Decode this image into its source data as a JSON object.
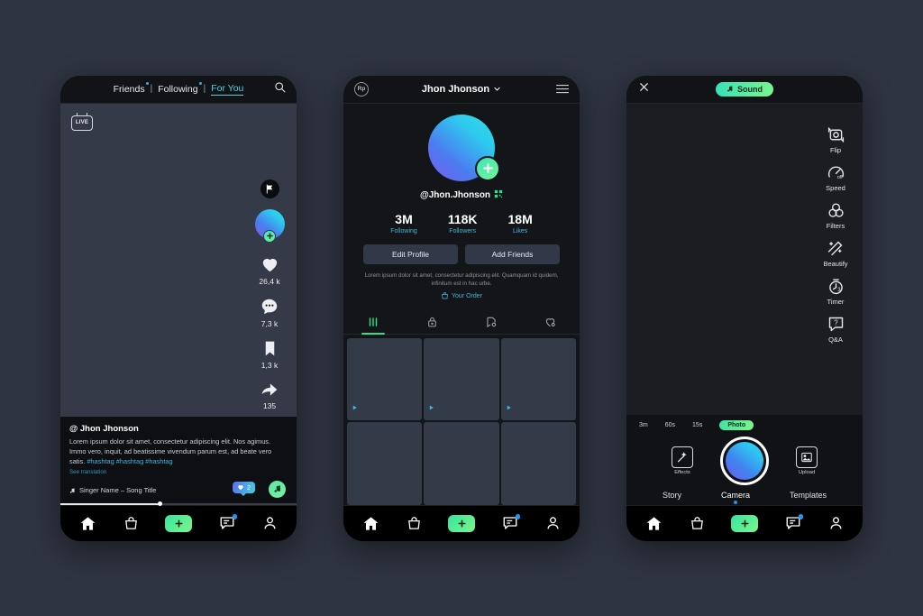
{
  "phone1": {
    "tabs": [
      {
        "label": "Friends",
        "has_dot": true,
        "active": false
      },
      {
        "label": "Following",
        "has_dot": true,
        "active": false
      },
      {
        "label": "For You",
        "has_dot": false,
        "active": true
      }
    ],
    "separator": "|",
    "search_icon": "search-icon",
    "live_badge": "LIVE",
    "actions": [
      {
        "icon": "flag-icon",
        "count": ""
      },
      {
        "icon": "avatar-follow-icon",
        "count": ""
      },
      {
        "icon": "heart-icon",
        "count": "26,4 k"
      },
      {
        "icon": "comment-icon",
        "count": "7,3 k"
      },
      {
        "icon": "bookmark-icon",
        "count": "1,3 k"
      },
      {
        "icon": "share-icon",
        "count": "135"
      }
    ],
    "caption": {
      "username": "@ Jhon Jhonson",
      "text": "Lorem ipsum dolor sit amet, consectetur adipiscing elit. Nos agimus. Immo vero, inquit, ad beatissime vivendum parum est, ad beate vero satis. ",
      "hashtags": "#hashtag #hashtag #hashtag",
      "translate": "See translation",
      "song": "Singer Name – Song Title",
      "like_chip_count": "2"
    }
  },
  "phone2": {
    "header": {
      "left_icon_label": "Rp",
      "title": "Jhon Jhonson",
      "chevron": "chevron-down-icon",
      "menu": "hamburger-menu-icon"
    },
    "handle": "@Jhon.Jhonson",
    "stats": [
      {
        "value": "3M",
        "label": "Following"
      },
      {
        "value": "118K",
        "label": "Followers"
      },
      {
        "value": "18M",
        "label": "Likes"
      }
    ],
    "buttons": [
      {
        "label": "Edit Profile"
      },
      {
        "label": "Add Friends"
      }
    ],
    "bio": "Lorem ipsum dolor sit amet, consectetur adipiscing elit. Quamquam id quidem, infinitum est in hac urbe.",
    "order_link": "Your Order",
    "tabs": [
      {
        "icon": "grid-posts-icon",
        "active": true
      },
      {
        "icon": "lock-private-icon",
        "active": false
      },
      {
        "icon": "repost-icon",
        "active": false
      },
      {
        "icon": "liked-heart-icon",
        "active": false
      }
    ],
    "grid_cells": 6
  },
  "phone3": {
    "close_icon": "close-icon",
    "sound_label": "Sound",
    "tools": [
      {
        "icon": "flip-camera-icon",
        "label": "Flip"
      },
      {
        "icon": "speed-icon",
        "label": "Speed",
        "sub": "off"
      },
      {
        "icon": "filters-icon",
        "label": "Filters"
      },
      {
        "icon": "beautify-icon",
        "label": "Beautify"
      },
      {
        "icon": "timer-icon",
        "label": "Timer",
        "sub": "3"
      },
      {
        "icon": "qa-icon",
        "label": "Q&A"
      }
    ],
    "durations": [
      {
        "label": "3m",
        "active": false
      },
      {
        "label": "60s",
        "active": false
      },
      {
        "label": "15s",
        "active": false
      },
      {
        "label": "Photo",
        "active": true
      }
    ],
    "effects_label": "Effects",
    "upload_label": "Upload",
    "modes": [
      {
        "label": "Story",
        "active": false
      },
      {
        "label": "Camera",
        "active": true
      },
      {
        "label": "Templates",
        "active": false
      }
    ]
  },
  "bottom_nav": [
    {
      "icon": "home-icon",
      "badge": false
    },
    {
      "icon": "shop-bag-icon",
      "badge": false
    },
    {
      "icon": "create-plus-icon",
      "badge": false
    },
    {
      "icon": "inbox-message-icon",
      "badge": true
    },
    {
      "icon": "profile-person-icon",
      "badge": false
    }
  ],
  "colors": {
    "background": "#2e3440",
    "accent_green": "#4ae8a0",
    "accent_cyan": "#3fb8d6",
    "accent_blue": "#2196f3"
  }
}
